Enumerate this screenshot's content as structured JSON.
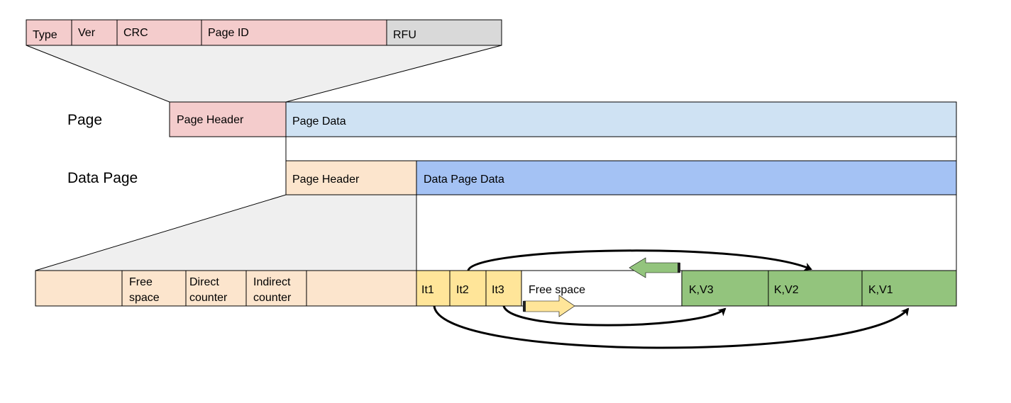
{
  "header_fields": [
    "Type",
    "Ver",
    "CRC",
    "Page ID",
    "RFU"
  ],
  "page": {
    "label": "Page",
    "header": "Page Header",
    "data": "Page Data"
  },
  "data_page": {
    "label": "Data Page",
    "header": "Page Header",
    "data": "Data Page Data"
  },
  "data_page_header_fields": [
    {
      "line1": "",
      "line2": ""
    },
    {
      "line1": "Free",
      "line2": "space"
    },
    {
      "line1": "Direct",
      "line2": "counter"
    },
    {
      "line1": "Indirect",
      "line2": "counter"
    },
    {
      "line1": "",
      "line2": ""
    }
  ],
  "items": [
    "It1",
    "It2",
    "It3"
  ],
  "free_space": "Free space",
  "kv": [
    "K,V3",
    "K,V2",
    "K,V1"
  ],
  "colors": {
    "page_header": "#f4cccc",
    "rfu": "#d9d9d9",
    "page_data": "#cfe2f3",
    "data_page_data": "#a4c2f4",
    "data_page_header": "#fce5cd",
    "items": "#ffe599",
    "kv": "#93c47d",
    "zoom_fill": "#efefef"
  }
}
